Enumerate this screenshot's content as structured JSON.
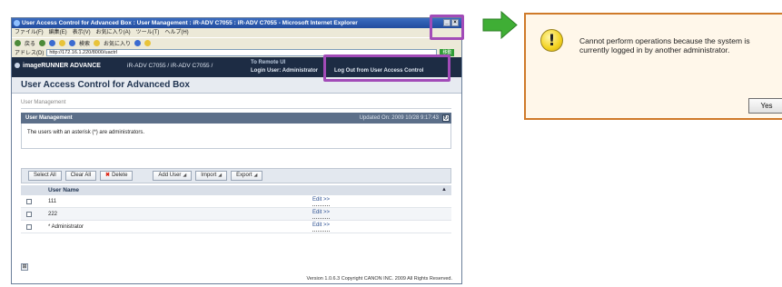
{
  "browser": {
    "title": "User Access Control for Advanced Box : User Management : iR-ADV C7055 : iR-ADV C7055 - Microsoft Internet Explorer",
    "menu": [
      "ファイル(F)",
      "編集(E)",
      "表示(V)",
      "お気に入り(A)",
      "ツール(T)",
      "ヘルプ(H)"
    ],
    "toolbar": {
      "back": "戻る",
      "search": "検索",
      "favorites": "お気に入り"
    },
    "address_label": "アドレス(D)",
    "address": "http://172.16.1.220/8000/uactrl",
    "go": "移動"
  },
  "header": {
    "product": "imageRUNNER ADVANCE",
    "device": "iR-ADV C7055 / iR-ADV C7055 /",
    "remote_ui": "To Remote UI",
    "login_user": "Login User: Administrator",
    "logout": "Log Out from User Access Control"
  },
  "page": {
    "title": "User Access Control for Advanced Box",
    "breadcrumb": "User Management",
    "panel_title": "User Management",
    "updated": "Updated On: 2009 10/28 9:17:43",
    "note": "The users with an asterisk (*) are administrators."
  },
  "actions": {
    "select_all": "Select All",
    "clear_all": "Clear All",
    "delete": "Delete",
    "add_user": "Add User",
    "import": "Import",
    "export": "Export"
  },
  "table": {
    "header": "User Name",
    "rows": [
      {
        "name": "111",
        "edit": "Edit >>"
      },
      {
        "name": "222",
        "edit": "Edit >>"
      },
      {
        "name": "* Administrator",
        "edit": "Edit >>"
      }
    ]
  },
  "footer": "Version 1.0.6.3 Copyright CANON INC. 2009 All Rights Reserved.",
  "dialog": {
    "message": "Cannot perform operations because the system is currently logged in by another administrator.",
    "yes": "Yes"
  },
  "colors": {
    "highlight": "#a24bb8",
    "arrow": "#3fae35",
    "dialog_border": "#cf7a2a"
  }
}
